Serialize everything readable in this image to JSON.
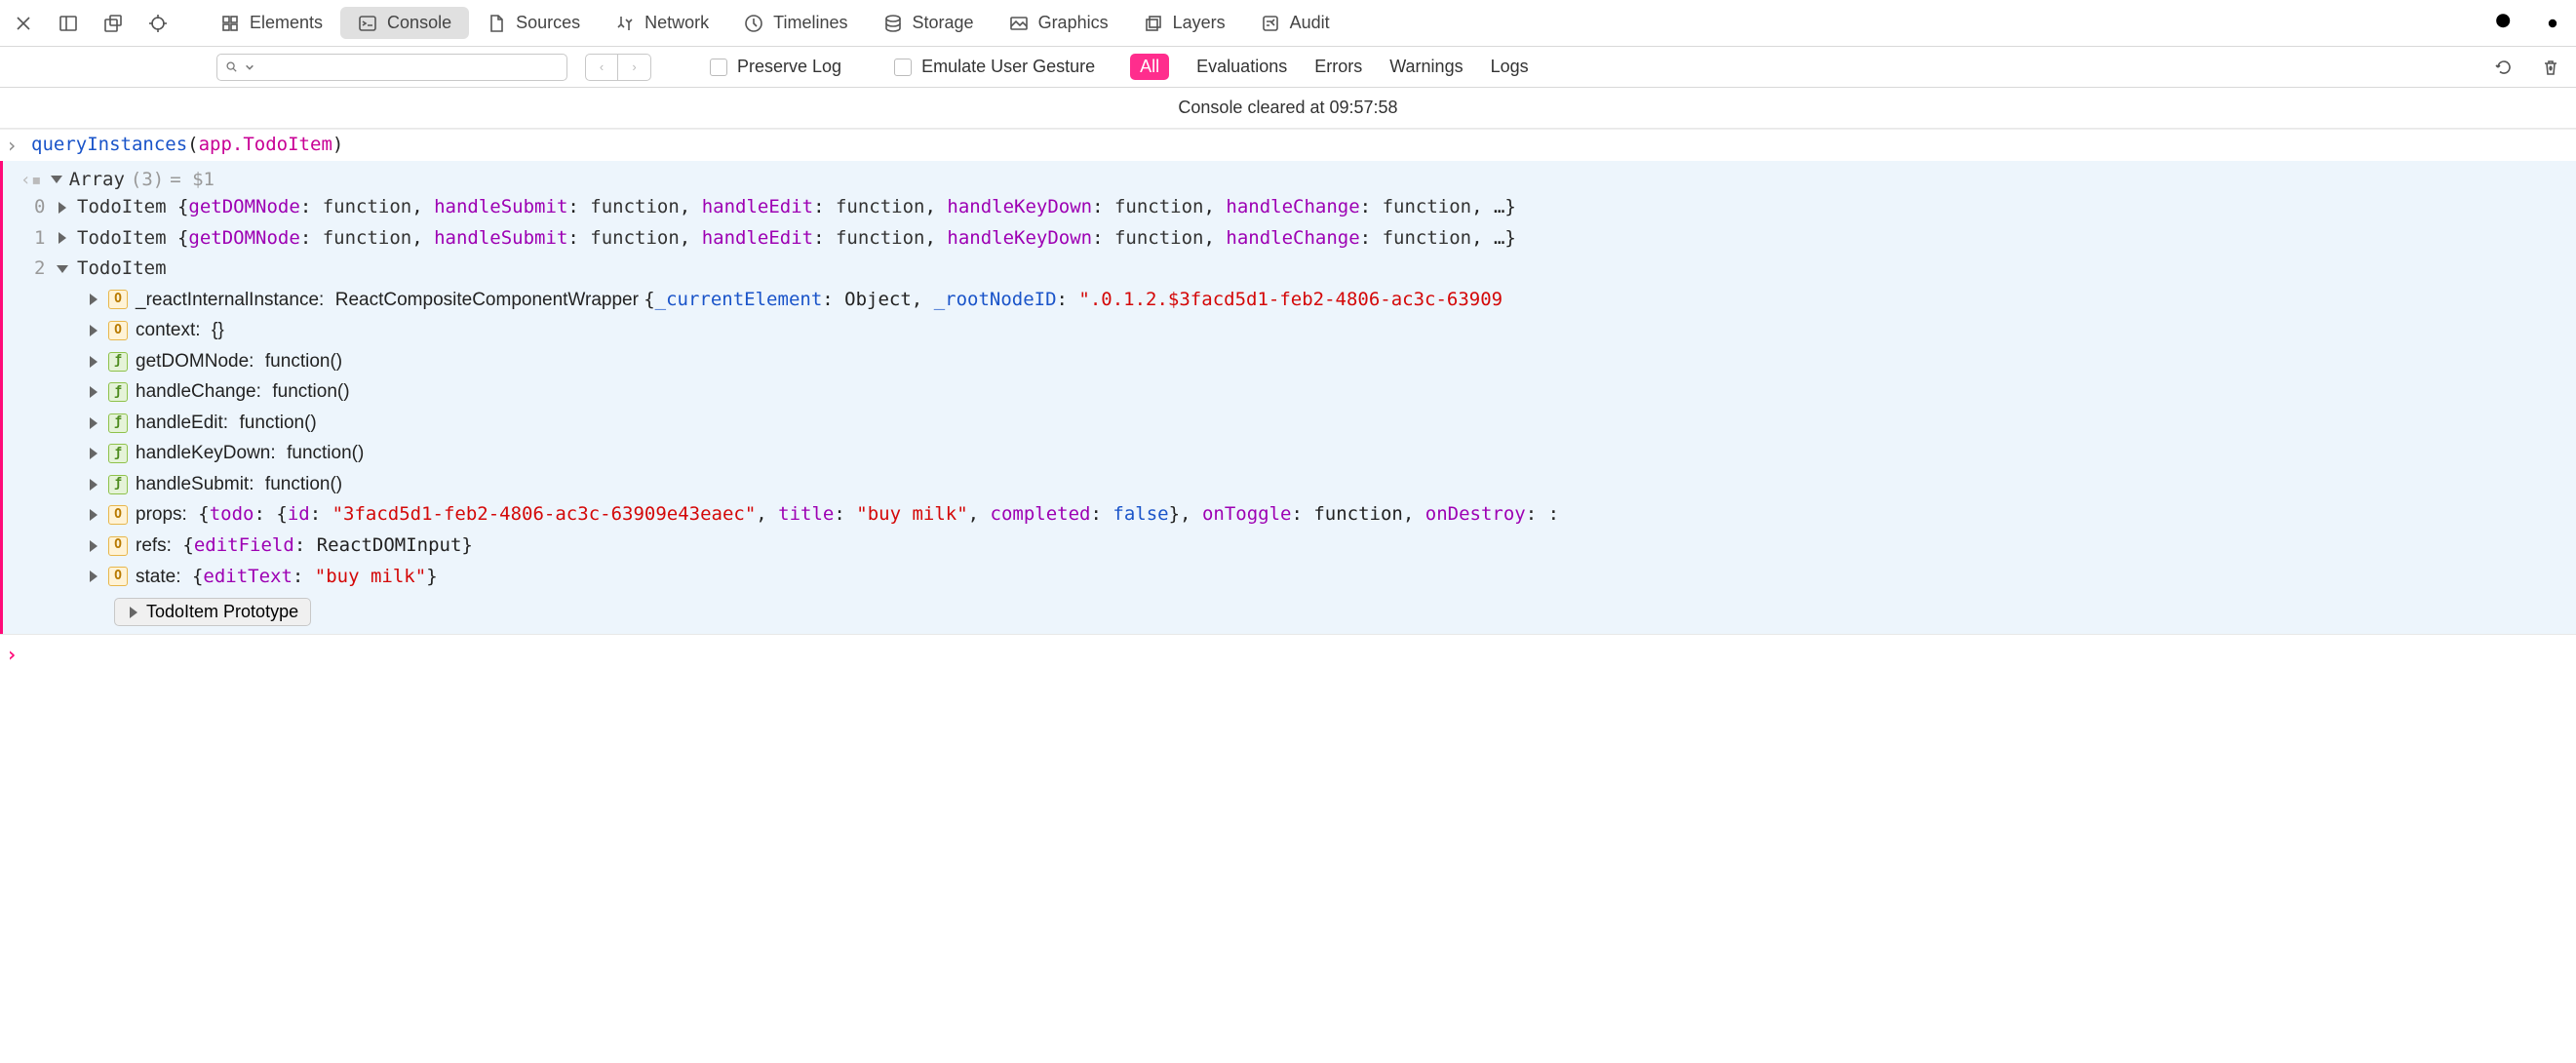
{
  "toolbar": {
    "tabs": [
      {
        "label": "Elements"
      },
      {
        "label": "Console"
      },
      {
        "label": "Sources"
      },
      {
        "label": "Network"
      },
      {
        "label": "Timelines"
      },
      {
        "label": "Storage"
      },
      {
        "label": "Graphics"
      },
      {
        "label": "Layers"
      },
      {
        "label": "Audit"
      }
    ]
  },
  "consoleToolbar": {
    "preserve_log_label": "Preserve Log",
    "emulate_gesture_label": "Emulate User Gesture",
    "filters": {
      "all": "All",
      "evaluations": "Evaluations",
      "errors": "Errors",
      "warnings": "Warnings",
      "logs": "Logs"
    }
  },
  "status": "Console cleared at 09:57:58",
  "command": {
    "fn": "queryInstances",
    "arg": "app.TodoItem"
  },
  "result": {
    "header_type": "Array",
    "header_count": "(3)",
    "header_assign": "= $1",
    "rows_collapsed": [
      {
        "idx": "0",
        "name": "TodoItem",
        "props": [
          {
            "k": "getDOMNode",
            "v": "function"
          },
          {
            "k": "handleSubmit",
            "v": "function"
          },
          {
            "k": "handleEdit",
            "v": "function"
          },
          {
            "k": "handleKeyDown",
            "v": "function"
          },
          {
            "k": "handleChange",
            "v": "function"
          }
        ],
        "ellipsis": ", …}"
      },
      {
        "idx": "1",
        "name": "TodoItem",
        "props": [
          {
            "k": "getDOMNode",
            "v": "function"
          },
          {
            "k": "handleSubmit",
            "v": "function"
          },
          {
            "k": "handleEdit",
            "v": "function"
          },
          {
            "k": "handleKeyDown",
            "v": "function"
          },
          {
            "k": "handleChange",
            "v": "function"
          }
        ],
        "ellipsis": ", …}"
      }
    ],
    "expanded": {
      "idx": "2",
      "name": "TodoItem",
      "members": [
        {
          "badge": "O",
          "key": "_reactInternalInstance",
          "val_prefix": "ReactCompositeComponentWrapper {",
          "inner": [
            {
              "k": "_currentElement",
              "v": "Object",
              "kcolor": "blue"
            },
            {
              "k": "_rootNodeID",
              "v": "\".0.1.2.$3facd5d1-feb2-4806-ac3c-63909",
              "kcolor": "blue",
              "vcolor": "str"
            }
          ]
        },
        {
          "badge": "O",
          "key": "context",
          "val_plain": "{}"
        },
        {
          "badge": "f",
          "key": "getDOMNode",
          "val_plain": "function()"
        },
        {
          "badge": "f",
          "key": "handleChange",
          "val_plain": "function()"
        },
        {
          "badge": "f",
          "key": "handleEdit",
          "val_plain": "function()"
        },
        {
          "badge": "f",
          "key": "handleKeyDown",
          "val_plain": "function()"
        },
        {
          "badge": "f",
          "key": "handleSubmit",
          "val_plain": "function()"
        },
        {
          "badge": "O",
          "key": "props",
          "val_prefix": "{",
          "inner": [
            {
              "k": "todo",
              "nested": true,
              "open": "{",
              "children": [
                {
                  "k": "id",
                  "v": "\"3facd5d1-feb2-4806-ac3c-63909e43eaec\"",
                  "vcolor": "str"
                },
                {
                  "k": "title",
                  "v": "\"buy milk\"",
                  "vcolor": "str"
                },
                {
                  "k": "completed",
                  "v": "false",
                  "vcolor": "false"
                }
              ],
              "close": "}"
            },
            {
              "k": "onToggle",
              "v": "function"
            },
            {
              "k": "onDestroy",
              "v": ""
            }
          ],
          "trail": ": "
        },
        {
          "badge": "O",
          "key": "refs",
          "val_prefix": "{",
          "inner": [
            {
              "k": "editField",
              "v": "ReactDOMInput"
            }
          ],
          "val_suffix": "}"
        },
        {
          "badge": "O",
          "key": "state",
          "val_prefix": "{",
          "inner": [
            {
              "k": "editText",
              "v": "\"buy milk\"",
              "vcolor": "str"
            }
          ],
          "val_suffix": "}"
        }
      ],
      "proto_label": "TodoItem Prototype"
    }
  }
}
